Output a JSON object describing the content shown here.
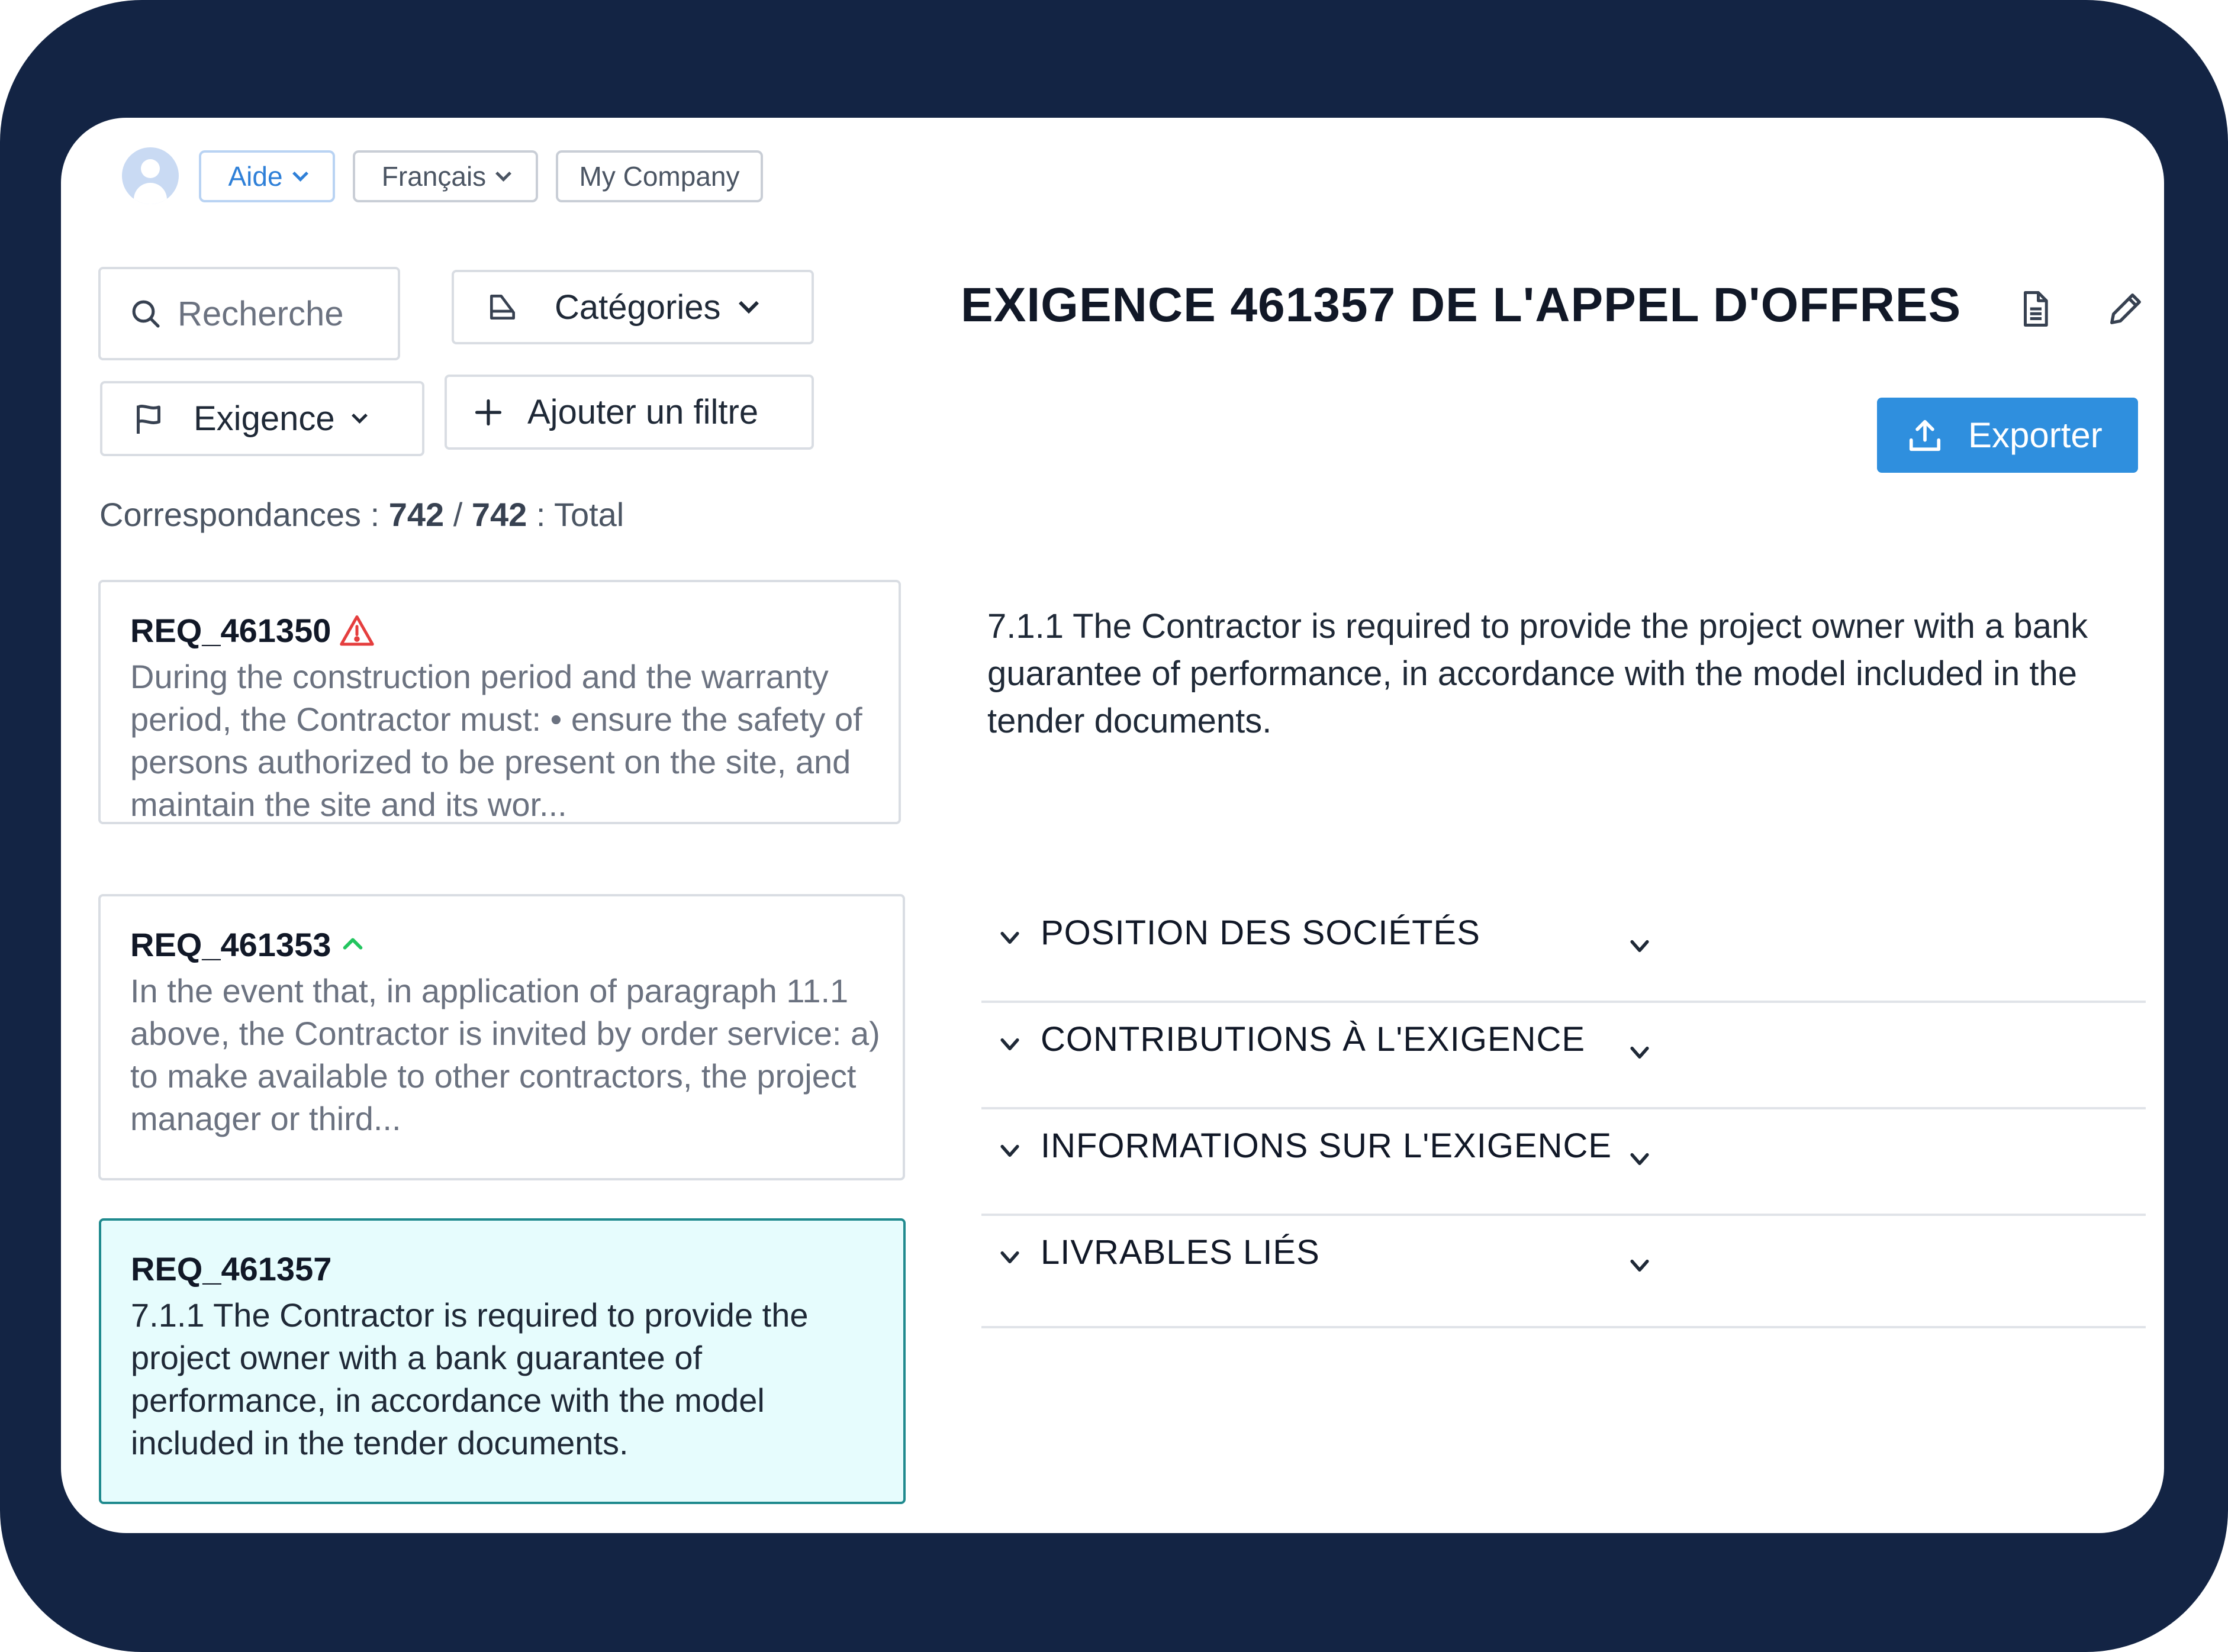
{
  "topbar": {
    "help_label": "Aide",
    "language_label": "Français",
    "company_label": "My Company"
  },
  "filters": {
    "search_placeholder": "Recherche",
    "categories_label": "Catégories",
    "requirement_label": "Exigence",
    "add_filter_label": "Ajouter un filtre"
  },
  "matches": {
    "prefix": "Correspondances :",
    "count": "742",
    "separator": "/",
    "total": "742",
    "suffix": ": Total"
  },
  "requirements": [
    {
      "id": "REQ_461350",
      "status_icon": "warning-icon",
      "text": "During the construction period and the warranty period, the Contractor must: • ensure the safety of persons authorized to be present on the site, and maintain the site and its wor..."
    },
    {
      "id": "REQ_461353",
      "status_icon": "chevron-up-icon",
      "text": "In the event that, in application of paragraph 11.1 above, the Contractor is invited by order service: a) to make available to other contractors, the project manager or third..."
    },
    {
      "id": "REQ_461357",
      "selected": true,
      "text": "7.1.1 The Contractor is required to provide the project owner with a bank guarantee of performance, in accordance with the model included in the tender documents."
    }
  ],
  "detail": {
    "title": "EXIGENCE 461357 DE L'APPEL D'OFFRES",
    "export_label": "Exporter",
    "description": "7.1.1 The Contractor is required to provide the project owner with a bank guarantee of performance, in accordance with the model included in the tender documents.",
    "sections": [
      "POSITION DES SOCIÉTÉS",
      "CONTRIBUTIONS À L'EXIGENCE",
      "INFORMATIONS SUR L'EXIGENCE",
      "LIVRABLES LIÉS"
    ]
  },
  "colors": {
    "frame": "#132444",
    "accent": "#2f8fde",
    "selected_bg": "#e6fcfd",
    "selected_border": "#1f8a8e",
    "warning": "#e53e3e",
    "success": "#22c55e"
  }
}
